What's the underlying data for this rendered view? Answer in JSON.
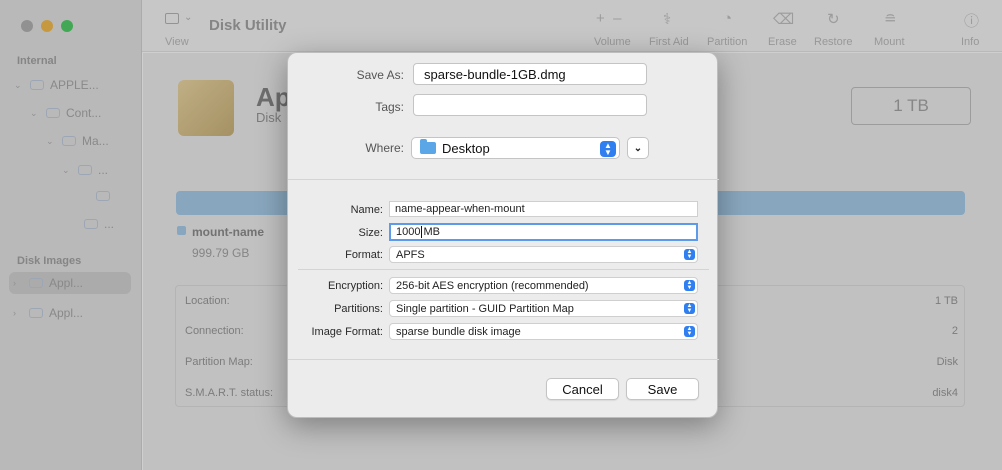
{
  "window": {
    "title": "Disk Utility",
    "toolbar": {
      "view_label": "View",
      "actions": [
        {
          "label": "Volume",
          "icon": "plus-minus-icon"
        },
        {
          "label": "First Aid",
          "icon": "stethoscope-icon"
        },
        {
          "label": "Partition",
          "icon": "pie-icon"
        },
        {
          "label": "Erase",
          "icon": "eraser-icon"
        },
        {
          "label": "Restore",
          "icon": "restore-icon"
        },
        {
          "label": "Mount",
          "icon": "mount-icon"
        },
        {
          "label": "Info",
          "icon": "info-icon"
        }
      ]
    },
    "sidebar": {
      "internal_label": "Internal",
      "disk_images_label": "Disk Images",
      "internal_items": [
        "APPLE...",
        "Cont...",
        "Ma...",
        "...",
        "",
        "..."
      ],
      "image_items": [
        "Appl...",
        "Appl..."
      ]
    },
    "main": {
      "disk_name": "Ap",
      "disk_sub": "Disk",
      "capacity": "1 TB",
      "legend_name": "mount-name",
      "legend_size": "999.79 GB",
      "info_rows": [
        {
          "label": "Location:",
          "value": "1 TB"
        },
        {
          "label": "Connection:",
          "value": "2"
        },
        {
          "label": "Partition Map:",
          "value": "Disk"
        },
        {
          "label": "S.M.A.R.T. status:",
          "value": "disk4"
        }
      ]
    }
  },
  "dialog": {
    "save_as_label": "Save As:",
    "save_as_value": "sparse-bundle-1GB.dmg",
    "tags_label": "Tags:",
    "tags_value": "",
    "where_label": "Where:",
    "where_value": "Desktop",
    "name_label": "Name:",
    "name_value": "name-appear-when-mount",
    "size_label": "Size:",
    "size_number": "1000",
    "size_unit": "MB",
    "format_label": "Format:",
    "format_value": "APFS",
    "encryption_label": "Encryption:",
    "encryption_value": "256-bit AES encryption (recommended)",
    "partitions_label": "Partitions:",
    "partitions_value": "Single partition - GUID Partition Map",
    "image_format_label": "Image Format:",
    "image_format_value": "sparse bundle disk image",
    "cancel_label": "Cancel",
    "save_label": "Save",
    "colors": {
      "accent": "#2f7ff0",
      "focus_ring": "#5d9be8"
    }
  }
}
